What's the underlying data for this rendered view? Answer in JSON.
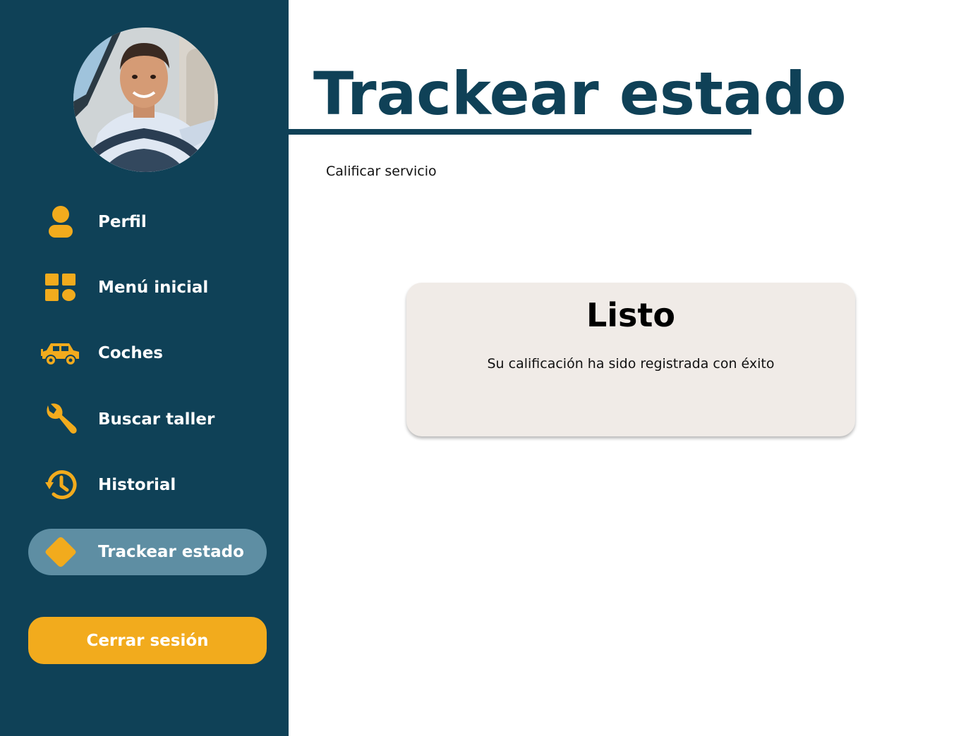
{
  "sidebar": {
    "avatar_alt": "Foto de perfil",
    "items": [
      {
        "label": "Perfil",
        "icon": "person-icon"
      },
      {
        "label": "Menú inicial",
        "icon": "dashboard-icon"
      },
      {
        "label": "Coches",
        "icon": "car-icon"
      },
      {
        "label": "Buscar taller",
        "icon": "wrench-icon"
      },
      {
        "label": "Historial",
        "icon": "history-icon"
      },
      {
        "label": "Trackear estado",
        "icon": "diamond-icon",
        "active": true
      }
    ],
    "logout_label": "Cerrar sesión"
  },
  "main": {
    "title": "Trackear estado",
    "subtitle": "Calificar servicio",
    "dialog": {
      "title": "Listo",
      "message": "Su calificación ha sido registrada con éxito"
    }
  },
  "colors": {
    "sidebar": "#0f4157",
    "accent": "#f2ab1d",
    "active_item": "#5e8ea3",
    "card": "#f0ebe7"
  }
}
